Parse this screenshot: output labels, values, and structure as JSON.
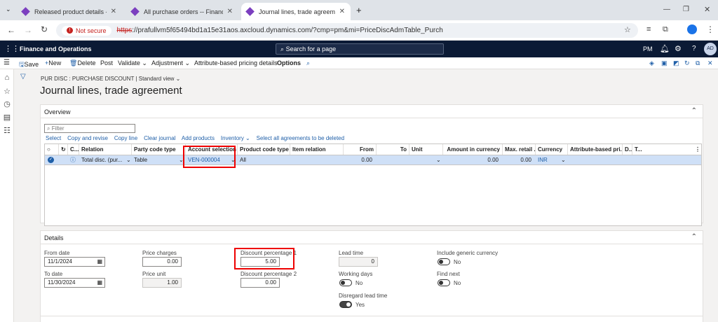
{
  "browser": {
    "tabs": [
      {
        "title": "Released product details -- Fina"
      },
      {
        "title": "All purchase orders -- Finance a"
      },
      {
        "title": "Journal lines, trade agreement"
      }
    ],
    "new_tab": "+",
    "not_secure": "Not secure",
    "url_scheme": "https",
    "url_rest": "://prafullvm5f65494bd1a15e31aos.axcloud.dynamics.com/?cmp=pm&mi=PriceDiscAdmTable_Purch"
  },
  "app": {
    "title": "Finance and Operations",
    "search_placeholder": "Search for a page",
    "company": "PM",
    "help": "?",
    "avatar": "AD"
  },
  "actions": {
    "save": "Save",
    "new": "New",
    "delete": "Delete",
    "post": "Post",
    "validate": "Validate",
    "adjustment": "Adjustment",
    "attr_pricing": "Attribute-based pricing details",
    "options": "Options"
  },
  "page": {
    "breadcrumb": "PUR DISC : PURCHASE DISCOUNT",
    "view": "Standard view",
    "title": "Journal lines, trade agreement"
  },
  "overview": {
    "header": "Overview",
    "filter_placeholder": "Filter",
    "toolbar": [
      "Select",
      "Copy and revise",
      "Copy line",
      "Clear journal",
      "Add products",
      "Inventory",
      "Select all agreements to be deleted"
    ],
    "columns": {
      "c": "C...",
      "relation": "Relation",
      "party_code_type": "Party code type",
      "account_selection": "Account selection",
      "product_code_type": "Product code type",
      "item_relation": "Item relation",
      "from": "From",
      "to": "To",
      "unit": "Unit",
      "amount": "Amount in currency",
      "max_retail": "Max. retail ...",
      "currency": "Currency",
      "attr_price": "Attribute-based pri...",
      "d": "D...",
      "t": "T..."
    },
    "row": {
      "relation": "Total disc. (pur...",
      "party_code_type": "Table",
      "account_selection": "VEN-000004",
      "product_code_type": "All",
      "from": "0.00",
      "amount": "0.00",
      "max_retail": "0.00",
      "currency": "INR"
    }
  },
  "details": {
    "header": "Details",
    "from_date_label": "From date",
    "from_date": "11/1/2024",
    "to_date_label": "To date",
    "to_date": "11/30/2024",
    "price_charges_label": "Price charges",
    "price_charges": "0.00",
    "price_unit_label": "Price unit",
    "price_unit": "1.00",
    "disc_pct1_label": "Discount percentage 1",
    "disc_pct1": "5.00",
    "disc_pct2_label": "Discount percentage 2",
    "disc_pct2": "0.00",
    "lead_time_label": "Lead time",
    "lead_time": "0",
    "working_days_label": "Working days",
    "working_days": "No",
    "disregard_label": "Disregard lead time",
    "disregard": "Yes",
    "generic_currency_label": "Include generic currency",
    "generic_currency": "No",
    "find_next_label": "Find next",
    "find_next": "No"
  },
  "colors": {
    "accent": "#1f5fa8",
    "header_bg": "#0b1a35",
    "highlight": "#e00000",
    "selected_row": "#cfe0f7"
  }
}
